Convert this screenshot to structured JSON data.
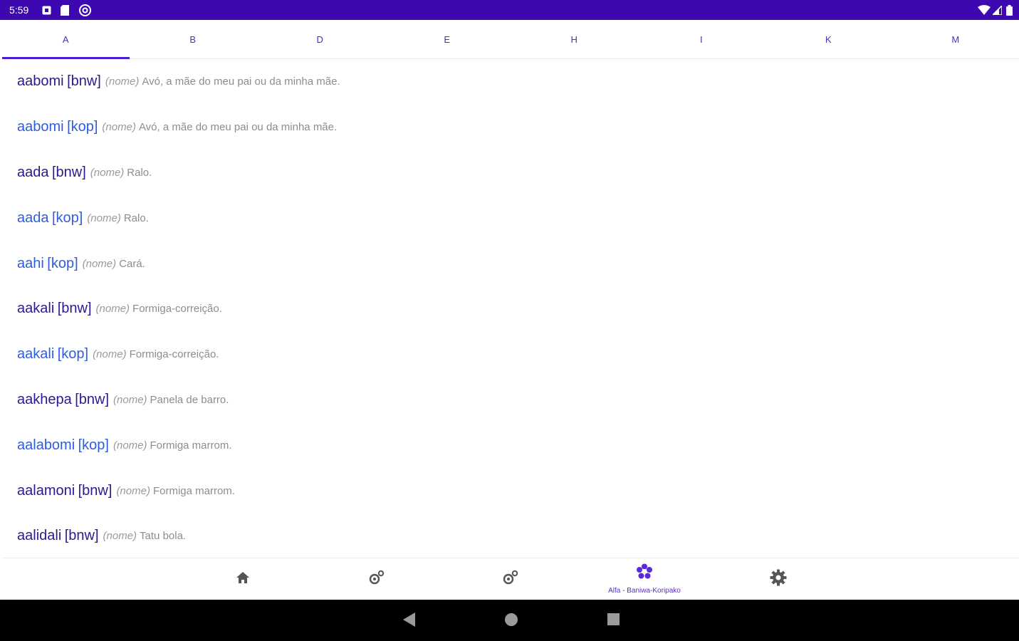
{
  "status_bar": {
    "time": "5:59",
    "left_icons": [
      "notification-square-icon",
      "sd-card-icon",
      "at-sign-icon"
    ],
    "right_icons": [
      "wifi-icon",
      "cell-signal-icon",
      "battery-icon"
    ]
  },
  "tabs": [
    {
      "label": "A",
      "active": true
    },
    {
      "label": "B",
      "active": false
    },
    {
      "label": "D",
      "active": false
    },
    {
      "label": "E",
      "active": false
    },
    {
      "label": "H",
      "active": false
    },
    {
      "label": "I",
      "active": false
    },
    {
      "label": "K",
      "active": false
    },
    {
      "label": "M",
      "active": false
    }
  ],
  "entries": [
    {
      "word": "aabomi",
      "lang": "[bnw]",
      "pos": "(nome)",
      "gloss": "Avó, a mãe do meu pai ou da minha mãe."
    },
    {
      "word": "aabomi",
      "lang": "[kop]",
      "pos": "(nome)",
      "gloss": "Avó, a mãe do meu pai ou da minha mãe."
    },
    {
      "word": "aada",
      "lang": "[bnw]",
      "pos": "(nome)",
      "gloss": "Ralo."
    },
    {
      "word": "aada",
      "lang": "[kop]",
      "pos": "(nome)",
      "gloss": "Ralo."
    },
    {
      "word": "aahi",
      "lang": "[kop]",
      "pos": "(nome)",
      "gloss": "Cará."
    },
    {
      "word": "aakali",
      "lang": "[bnw]",
      "pos": "(nome)",
      "gloss": "Formiga-correição."
    },
    {
      "word": "aakali",
      "lang": "[kop]",
      "pos": "(nome)",
      "gloss": "Formiga-correição."
    },
    {
      "word": "aakhepa",
      "lang": "[bnw]",
      "pos": "(nome)",
      "gloss": "Panela de barro."
    },
    {
      "word": "aalabomi",
      "lang": "[kop]",
      "pos": "(nome)",
      "gloss": "Formiga marrom."
    },
    {
      "word": "aalamoni",
      "lang": "[bnw]",
      "pos": "(nome)",
      "gloss": "Formiga marrom."
    },
    {
      "word": "aalidali",
      "lang": "[bnw]",
      "pos": "(nome)",
      "gloss": "Tatu  bola."
    }
  ],
  "bottom_nav": {
    "items": [
      {
        "icon": "home-icon",
        "label": ""
      },
      {
        "icon": "translate-icon",
        "label": ""
      },
      {
        "icon": "translate-icon",
        "label": ""
      },
      {
        "icon": "flower-icon",
        "label": "Alfa - Baniwa-Koripako",
        "active": true
      },
      {
        "icon": "gear-icon",
        "label": ""
      }
    ]
  },
  "colors": {
    "status_bar": "#3d08b0",
    "accent": "#4a1fd0",
    "bnw_word": "#2a1a8f",
    "kop_word": "#2e5de0",
    "gloss": "#8d8d8d"
  }
}
